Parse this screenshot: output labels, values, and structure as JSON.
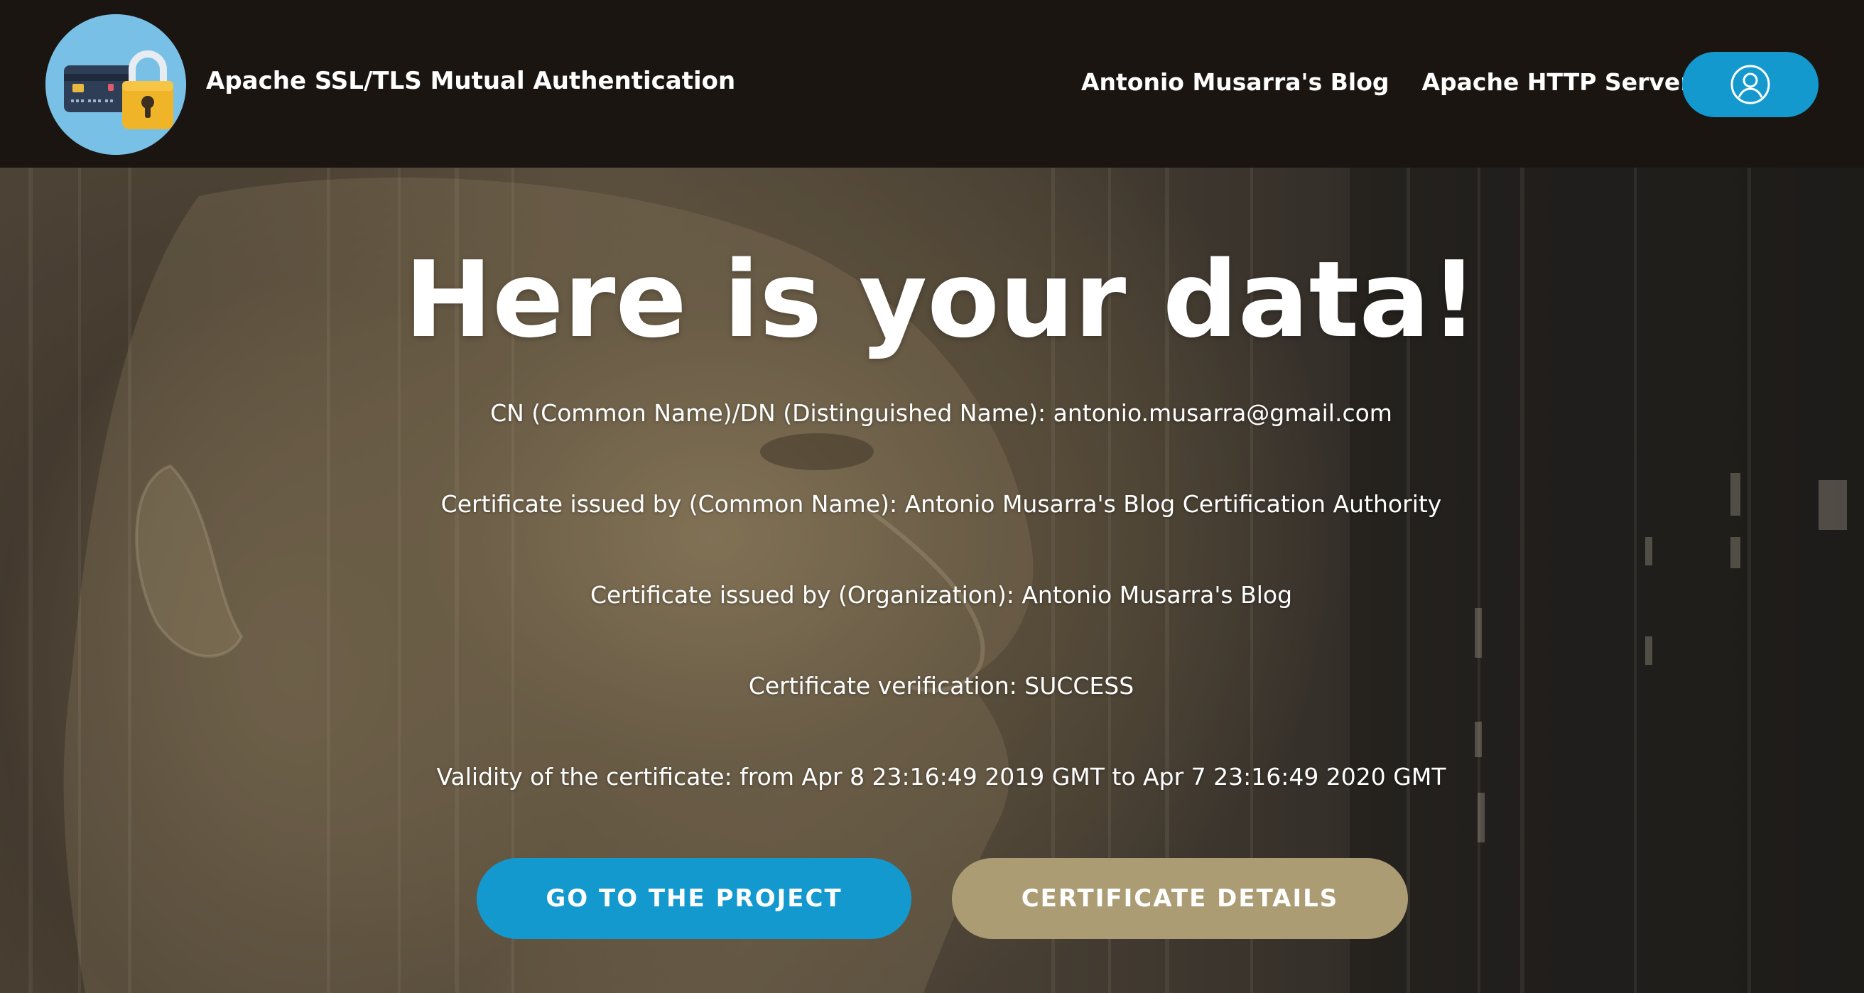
{
  "header": {
    "logo_icon": "card-and-padlock-icon",
    "title": "Apache SSL/TLS Mutual Authentication",
    "nav": [
      {
        "label": "Antonio Musarra's Blog"
      },
      {
        "label": "Apache HTTP Server"
      }
    ],
    "user_icon": "user-icon"
  },
  "hero": {
    "headline": "Here is your data!",
    "lines": [
      "CN (Common Name)/DN (Distinguished Name): antonio.musarra@gmail.com",
      "Certificate issued by (Common Name): Antonio Musarra's Blog Certification Authority",
      "Certificate issued by (Organization): Antonio Musarra's Blog",
      "Certificate verification: SUCCESS",
      "Validity of the certificate: from Apr 8 23:16:49 2019 GMT to Apr 7 23:16:49 2020 GMT"
    ],
    "buttons": {
      "primary": "GO TO THE PROJECT",
      "secondary": "CERTIFICATE DETAILS"
    }
  },
  "colors": {
    "topbar": "#1b1512",
    "accent_blue": "#1499cf",
    "accent_gold": "#ab9c74",
    "logo_bg": "#79c0e6"
  }
}
